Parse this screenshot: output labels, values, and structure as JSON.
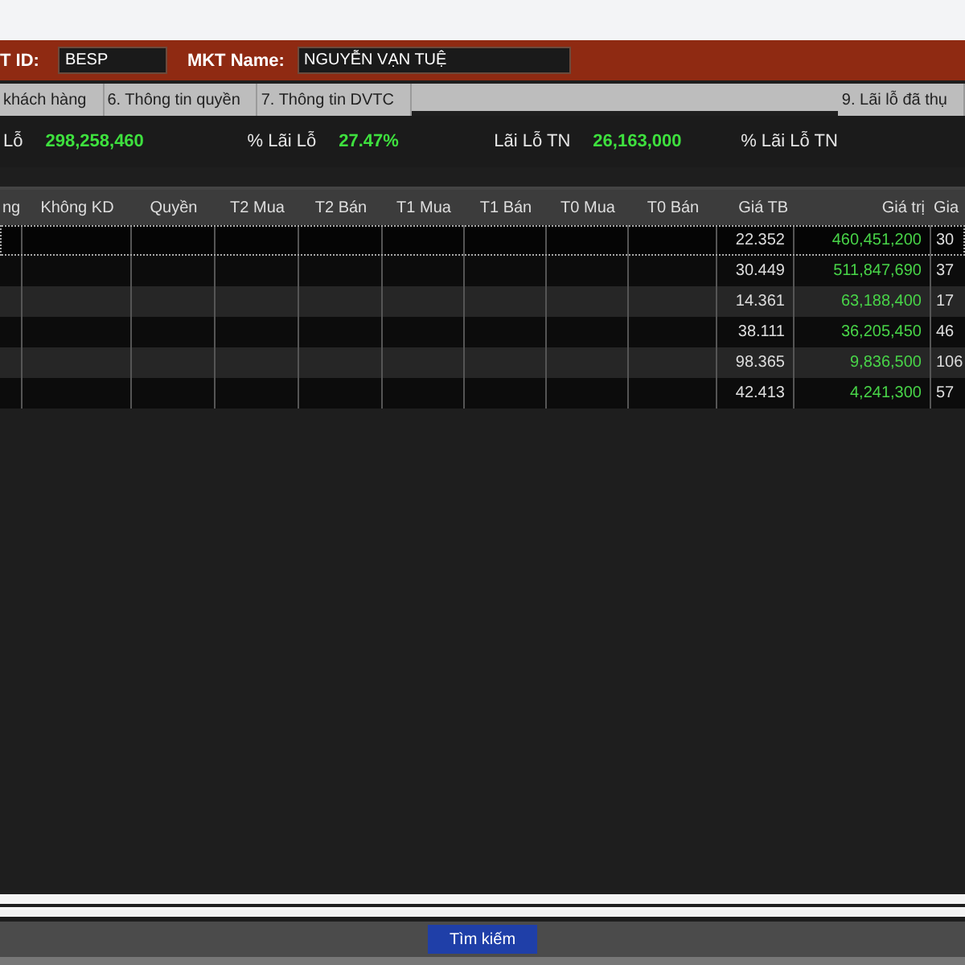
{
  "header": {
    "id_label": "T ID:",
    "id_value": "BESP",
    "name_label": "MKT Name:",
    "name_value": "NGUYỄN VẠN TUỆ"
  },
  "tabs": [
    {
      "label": "khách hàng",
      "selected": false
    },
    {
      "label": "6. Thông tin quyền",
      "selected": false
    },
    {
      "label": "7. Thông tin DVTC",
      "selected": false
    },
    {
      "label": "9. Lãi lỗ đã thụ",
      "selected": false
    }
  ],
  "summary": [
    {
      "label": "Lỗ",
      "value": "298,258,460"
    },
    {
      "label": "% Lãi Lỗ",
      "value": "27.47%"
    },
    {
      "label": "Lãi Lỗ TN",
      "value": "26,163,000"
    },
    {
      "label": "% Lãi Lỗ TN"
    }
  ],
  "table": {
    "columns": [
      "ng",
      "Không KD",
      "Quyền",
      "T2 Mua",
      "T2 Bán",
      "T1 Mua",
      "T1 Bán",
      "T0 Mua",
      "T0 Bán",
      "Giá TB",
      "Giá trị",
      "Gia"
    ],
    "rows": [
      {
        "selected": true,
        "gia_tb": "22.352",
        "gia_tri": "460,451,200",
        "column_12": "30"
      },
      {
        "selected": false,
        "gia_tb": "30.449",
        "gia_tri": "511,847,690",
        "column_12": "37"
      },
      {
        "selected": false,
        "gia_tb": "14.361",
        "gia_tri": "63,188,400",
        "column_12": "17"
      },
      {
        "selected": false,
        "gia_tb": "38.111",
        "gia_tri": "36,205,450",
        "column_12": "46"
      },
      {
        "selected": false,
        "gia_tb": "98.365",
        "gia_tri": "9,836,500",
        "column_12": "106"
      },
      {
        "selected": false,
        "gia_tb": "42.413",
        "gia_tri": "4,241,300",
        "column_12": "57"
      }
    ]
  },
  "search_button": "Tìm kiếm"
}
